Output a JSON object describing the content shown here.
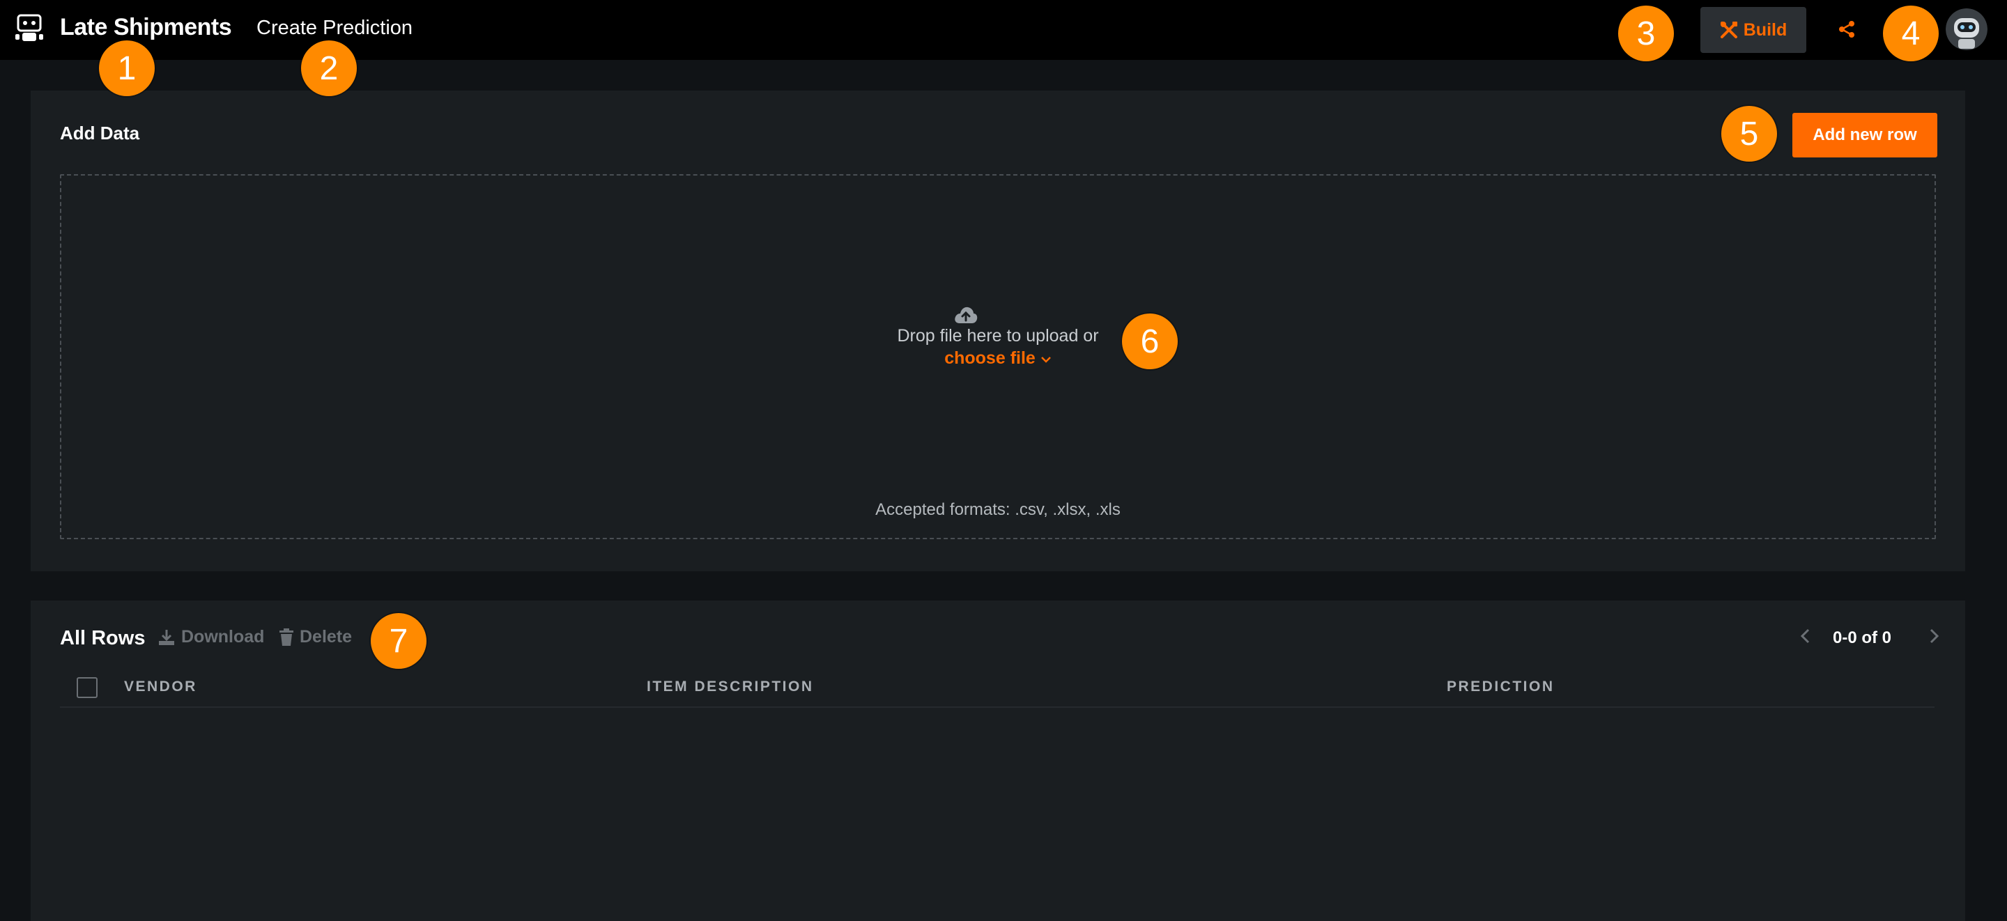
{
  "topbar": {
    "app_title": "Late Shipments",
    "tab_create": "Create Prediction",
    "build_label": "Build",
    "icons": {
      "app": "robot-app-icon",
      "build": "tools-icon",
      "share": "share-icon",
      "avatar": "robot-avatar"
    }
  },
  "markers": [
    "1",
    "2",
    "3",
    "4",
    "5",
    "6",
    "7"
  ],
  "add_data": {
    "title": "Add Data",
    "add_row_label": "Add new row",
    "drop_text": "Drop file here to upload or",
    "choose_file_label": "choose file",
    "accepted_formats": "Accepted formats: .csv, .xlsx, .xls"
  },
  "all_rows": {
    "title": "All Rows",
    "download_label": "Download",
    "delete_label": "Delete",
    "pager_text": "0-0 of 0",
    "columns": [
      "VENDOR",
      "ITEM DESCRIPTION",
      "PREDICTION"
    ]
  },
  "colors": {
    "accent": "#ff6a00",
    "marker": "#ff8a00",
    "background": "#101316",
    "panel": "#1a1e21"
  }
}
